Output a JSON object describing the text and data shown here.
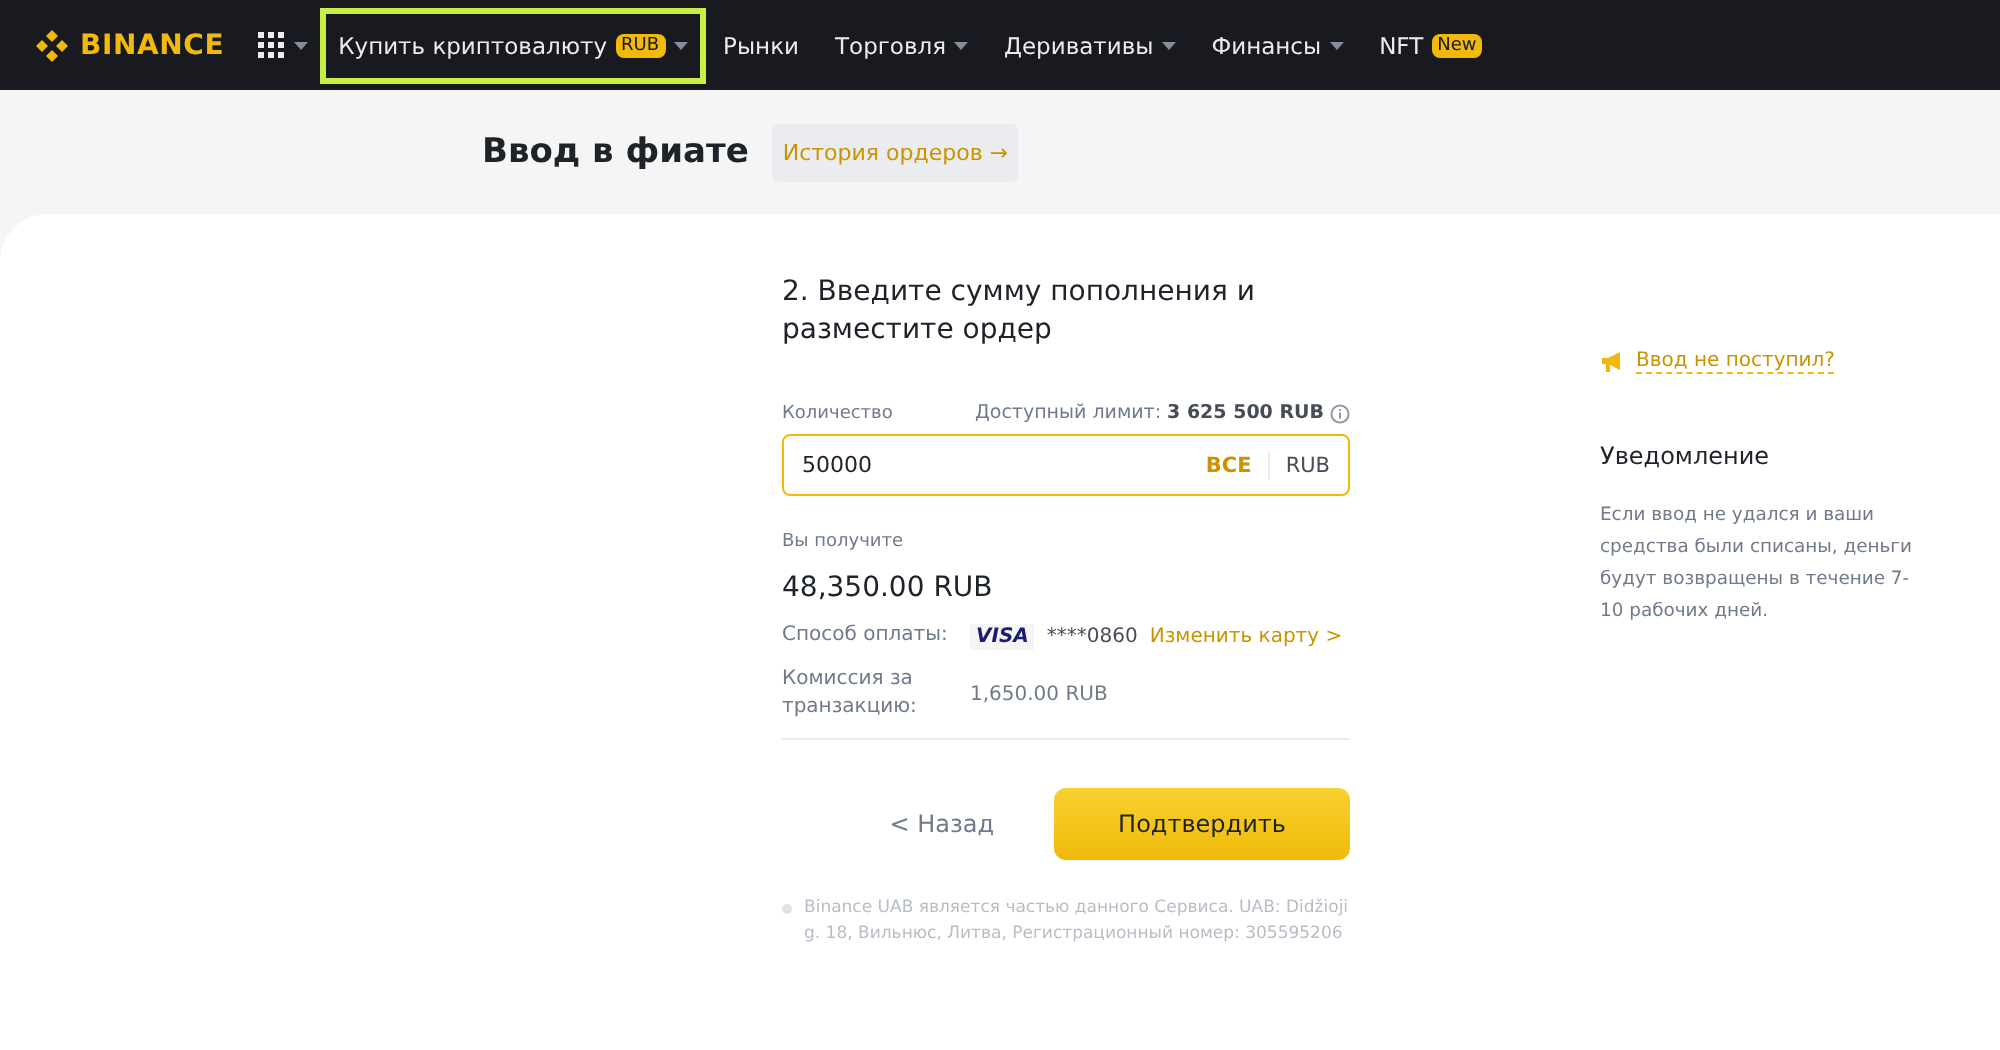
{
  "header": {
    "logo": "BINANCE",
    "nav": [
      {
        "label": "Купить криптовалюту",
        "badge": "RUB",
        "dropdown": true,
        "highlighted": true
      },
      {
        "label": "Рынки",
        "dropdown": false,
        "highlighted": false
      },
      {
        "label": "Торговля",
        "dropdown": true,
        "highlighted": false
      },
      {
        "label": "Деривативы",
        "dropdown": true,
        "highlighted": false
      },
      {
        "label": "Финансы",
        "dropdown": true,
        "highlighted": false
      },
      {
        "label": "NFT",
        "badge": "New",
        "dropdown": false,
        "highlighted": false
      }
    ]
  },
  "page": {
    "title": "Ввод в фиате",
    "history_link": "История ордеров →"
  },
  "form": {
    "step_title": "2. Введите сумму пополнения и разместите ордер",
    "amount_label": "Количество",
    "limit_label": "Доступный лимит:",
    "limit_value": "3 625 500 RUB",
    "amount_value": "50000",
    "max_button": "ВСЕ",
    "currency": "RUB",
    "receive_label": "Вы получите",
    "receive_value": "48,350.00 RUB",
    "payment_label": "Способ оплаты:",
    "card_brand": "VISA",
    "card_number": "****0860",
    "change_card": "Изменить карту >",
    "fee_label": "Комиссия за транзакцию:",
    "fee_value": "1,650.00 RUB",
    "back_button": "< Назад",
    "confirm_button": "Подтвердить",
    "footnote": "Binance UAB является частью данного Сервиса. UAB: Didžioji g. 18, Вильнюс, Литва, Регистрационный номер: 305595206"
  },
  "sidebar": {
    "help_link": "Ввод не поступил?",
    "notice_title": "Уведомление",
    "notice_text": "Если ввод не удался и ваши средства были списаны, деньги будут возвращены в течение 7-10 рабочих дней."
  }
}
